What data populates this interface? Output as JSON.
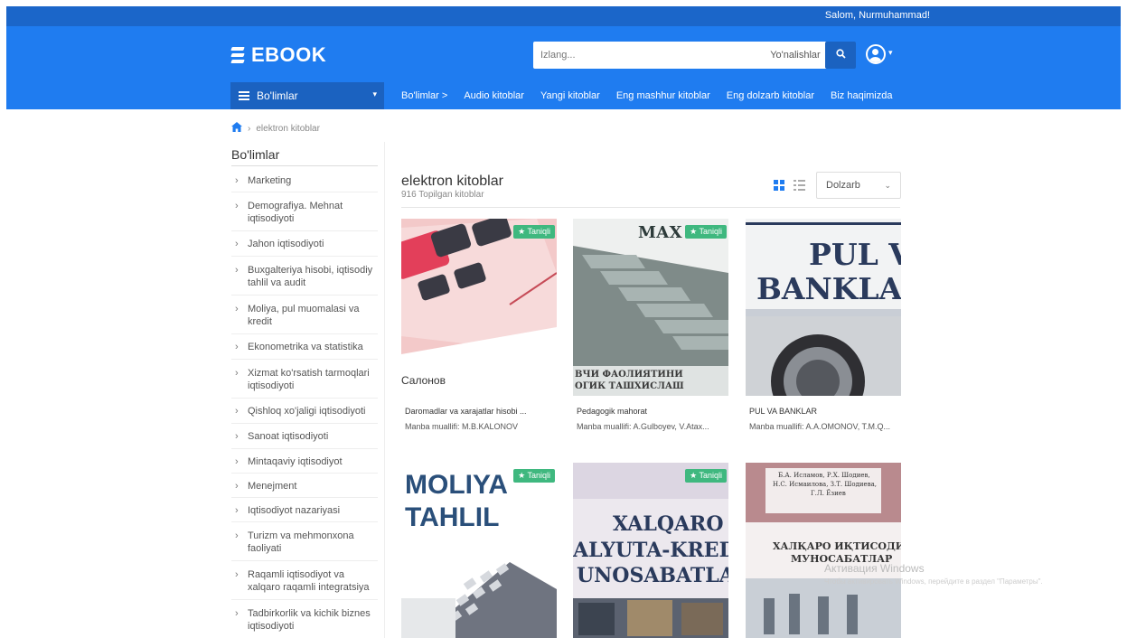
{
  "topbar": {
    "greeting": "Salom, Nurmuhammad!"
  },
  "header": {
    "logo": "EBOOK",
    "search_placeholder": "Izlang...",
    "search_category": "Yo'nalishlar",
    "bolimlar_button": "Bo'limlar",
    "nav": [
      "Bo'limlar >",
      "Audio kitoblar",
      "Yangi kitoblar",
      "Eng mashhur kitoblar",
      "Eng dolzarb kitoblar",
      "Biz haqimizda"
    ]
  },
  "breadcrumb": {
    "current": "elektron kitoblar"
  },
  "sidebar": {
    "title": "Bo'limlar",
    "items": [
      "Marketing",
      "Demografiya. Mehnat iqtisodiyoti",
      "Jahon iqtisodiyoti",
      "Buxgalteriya hisobi, iqtisodiy tahlil va audit",
      "Moliya, pul muomalasi va kredit",
      "Ekonometrika va statistika",
      "Xizmat ko'rsatish tarmoqlari iqtisodiyoti",
      "Qishloq xo'jaligi iqtisodiyoti",
      "Sanoat iqtisodiyoti",
      "Mintaqaviy iqtisodiyot",
      "Menejment",
      "Iqtisodiyot nazariyasi",
      "Turizm va mehmonxona faoliyati",
      "Raqamli iqtisodiyot va xalqaro raqamli integratsiya",
      "Tadbirkorlik va kichik biznes iqtisodiyoti"
    ]
  },
  "content": {
    "title": "elektron kitoblar",
    "count": "916 Topilgan kitoblar",
    "sort": "Dolzarb",
    "badge": "Taniqli",
    "books": [
      {
        "title": "Daromadlar va xarajatlar hisobi ...",
        "author": "Manba muallifi: M.B.KALONOV",
        "cover_text": [
          "Салонов"
        ]
      },
      {
        "title": "Pedagogik mahorat",
        "author": "Manba muallifi: A.Gulboyev, V.Atax...",
        "cover_text": [
          "МАХ",
          "ВЧИ ФАОЛИЯТИНИ",
          "ОГИК ТАШХИСЛАШ"
        ]
      },
      {
        "title": "PUL VA BANKLAR",
        "author": "Manba muallifi: A.A.OMONOV, T.M.Q...",
        "cover_text": [
          "PUL V",
          "BANKLA"
        ]
      },
      {
        "title": "",
        "author": "",
        "cover_text": [
          "MOLIYA",
          "TAHLIL"
        ]
      },
      {
        "title": "",
        "author": "",
        "cover_text": [
          "XALQARO",
          "ALYUTA-KRED",
          "UNOSABATLA"
        ]
      },
      {
        "title": "",
        "author": "",
        "cover_text": [
          "ХАЛҚАРО ИҚТИСОДИЙ",
          "МУНОСАБАТЛАР",
          "Б.А. Исламов, Р.Х. Шодиев,",
          "Н.С. Исмаилова, З.Т. Шодиева,",
          "Г.Л. Ёзиев"
        ]
      }
    ]
  },
  "os_watermark": {
    "title": "Активация Windows",
    "subtitle": "Чтобы активировать Windows, перейдите в раздел \"Параметры\"."
  },
  "colors": {
    "header": "#1f7cf0",
    "topbar": "#1b66c9",
    "badge": "#3fb87f"
  }
}
